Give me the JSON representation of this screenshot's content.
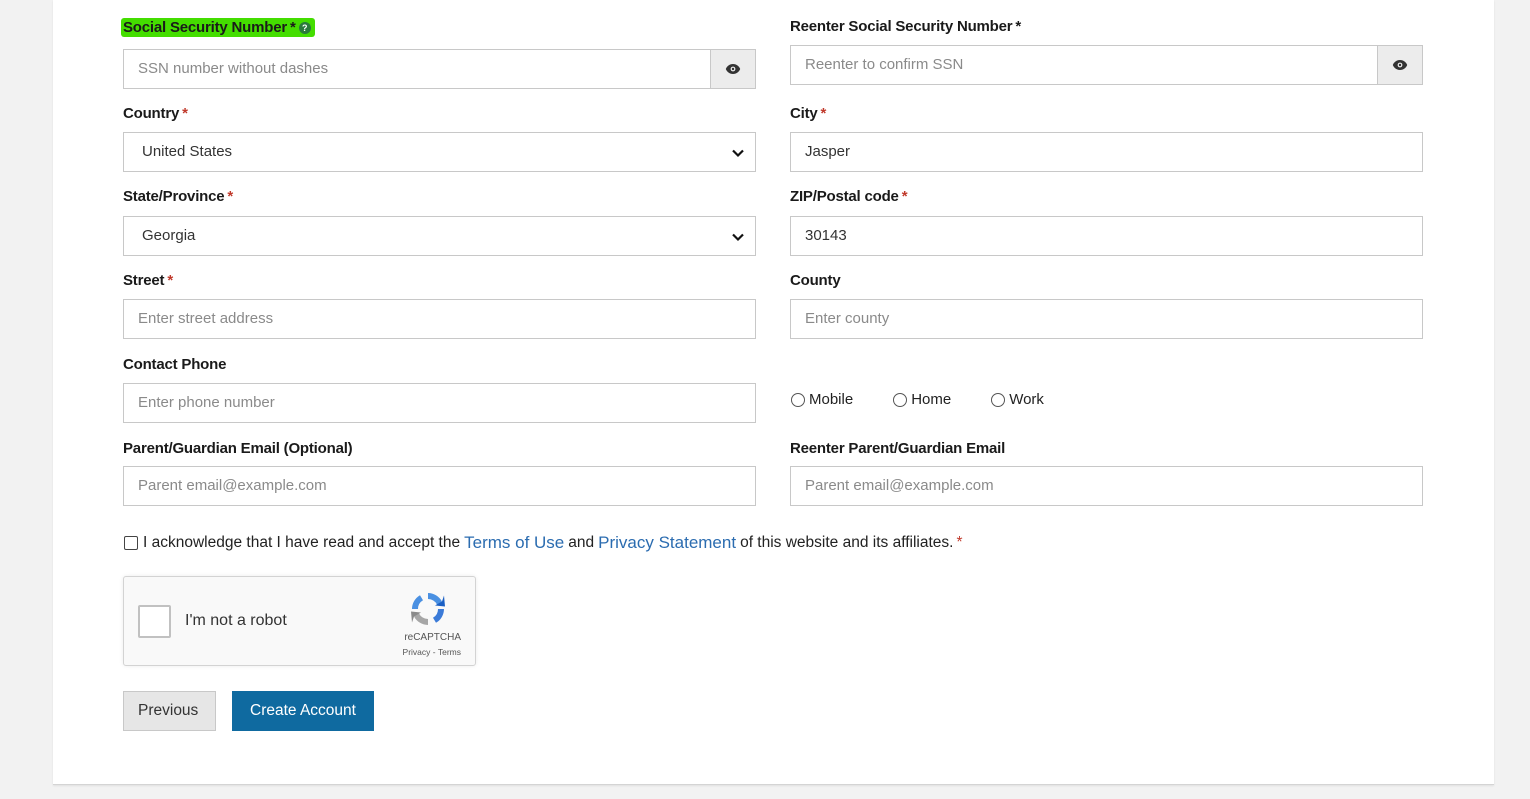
{
  "ssn": {
    "label": "Social Security Number",
    "required": "*",
    "help_icon": "question-circle-icon",
    "placeholder": "SSN number without dashes",
    "highlight_color": "#44dd00"
  },
  "ssn_confirm": {
    "label": "Reenter Social Security Number",
    "required": "*",
    "placeholder": "Reenter to confirm SSN"
  },
  "country": {
    "label": "Country",
    "required": "*",
    "value": "United States"
  },
  "city": {
    "label": "City",
    "required": "*",
    "value": "Jasper"
  },
  "state": {
    "label": "State/Province",
    "required": "*",
    "value": "Georgia"
  },
  "zip": {
    "label": "ZIP/Postal code",
    "required": "*",
    "value": "30143"
  },
  "street": {
    "label": "Street",
    "required": "*",
    "placeholder": "Enter street address"
  },
  "county": {
    "label": "County",
    "placeholder": "Enter county"
  },
  "phone": {
    "label": "Contact Phone",
    "placeholder": "Enter phone number",
    "types": [
      "Mobile",
      "Home",
      "Work"
    ]
  },
  "parent_email": {
    "label": "Parent/Guardian Email (Optional)",
    "placeholder": "Parent email@example.com"
  },
  "parent_email_confirm": {
    "label": "Reenter Parent/Guardian Email",
    "placeholder": "Parent email@example.com"
  },
  "acknowledge": {
    "prefix": "I acknowledge that I have read and accept the",
    "terms_link": "Terms of Use",
    "and": "and",
    "privacy_link": "Privacy Statement",
    "suffix": "of this website and its affiliates.",
    "required": "*",
    "link_color": "#2b6cb0"
  },
  "captcha": {
    "label": "I'm not a robot",
    "brand": "reCAPTCHA",
    "privacy": "Privacy",
    "separator": "-",
    "terms": "Terms"
  },
  "buttons": {
    "previous": "Previous",
    "create": "Create Account",
    "create_color": "#0f6aa0"
  },
  "icons": {
    "reveal": "eye-icon",
    "dropdown": "chevron-down-icon"
  }
}
